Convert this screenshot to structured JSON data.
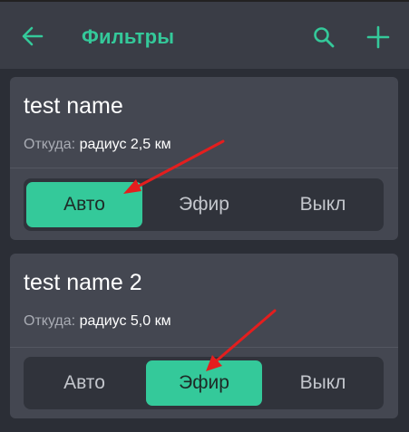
{
  "colors": {
    "accent": "#34c99a",
    "annotation": "#e41e1e"
  },
  "appbar": {
    "back_icon": "arrow-left-icon",
    "title": "Фильтры",
    "search_icon": "search-icon",
    "add_icon": "plus-icon"
  },
  "filters": [
    {
      "name": "test name",
      "from_label": "Откуда:",
      "from_value": "радиус 2,5 км",
      "options": [
        "Авто",
        "Эфир",
        "Выкл"
      ],
      "selected": "Авто"
    },
    {
      "name": "test name 2",
      "from_label": "Откуда:",
      "from_value": "радиус 5,0 км",
      "options": [
        "Авто",
        "Эфир",
        "Выкл"
      ],
      "selected": "Эфир"
    }
  ]
}
